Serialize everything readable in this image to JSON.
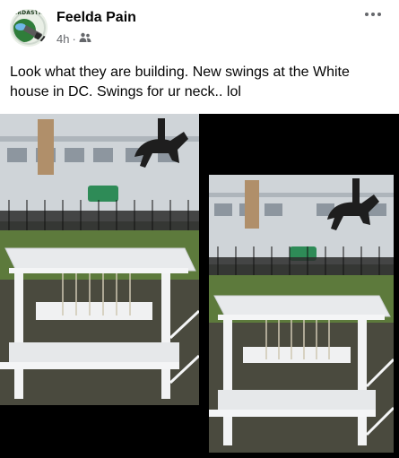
{
  "post": {
    "avatar_text": "ERDASTIN",
    "author": "Feelda Pain",
    "time": "4h",
    "separator": "·",
    "audience_icon": "friends-icon",
    "more_icon": "more-options-icon",
    "text": "Look what they are building.  New swings at the White house in DC. Swings for ur neck.. lol"
  },
  "media": {
    "images": [
      {
        "name": "photo-left"
      },
      {
        "name": "photo-right"
      }
    ]
  }
}
